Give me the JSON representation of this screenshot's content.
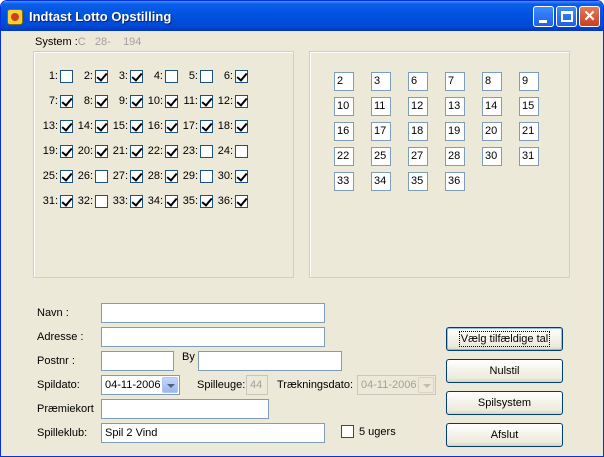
{
  "window": {
    "title": "Indtast Lotto Opstilling",
    "app_icon": "lotto-app-icon"
  },
  "system": {
    "label": "System :",
    "type": "C",
    "size": "28-",
    "rows": "194"
  },
  "numbers": [
    {
      "label": "1:",
      "checked": false
    },
    {
      "label": "2:",
      "checked": true
    },
    {
      "label": "3:",
      "checked": true
    },
    {
      "label": "4:",
      "checked": false
    },
    {
      "label": "5:",
      "checked": false
    },
    {
      "label": "6:",
      "checked": true
    },
    {
      "label": "7:",
      "checked": true
    },
    {
      "label": "8:",
      "checked": true
    },
    {
      "label": "9:",
      "checked": true
    },
    {
      "label": "10:",
      "checked": true
    },
    {
      "label": "11:",
      "checked": true
    },
    {
      "label": "12:",
      "checked": true
    },
    {
      "label": "13:",
      "checked": true
    },
    {
      "label": "14:",
      "checked": true
    },
    {
      "label": "15:",
      "checked": true
    },
    {
      "label": "16:",
      "checked": true
    },
    {
      "label": "17:",
      "checked": true
    },
    {
      "label": "18:",
      "checked": true
    },
    {
      "label": "19:",
      "checked": true
    },
    {
      "label": "20:",
      "checked": true
    },
    {
      "label": "21:",
      "checked": true
    },
    {
      "label": "22:",
      "checked": true
    },
    {
      "label": "23:",
      "checked": false
    },
    {
      "label": "24:",
      "checked": false
    },
    {
      "label": "25:",
      "checked": true
    },
    {
      "label": "26:",
      "checked": false
    },
    {
      "label": "27:",
      "checked": true
    },
    {
      "label": "28:",
      "checked": true
    },
    {
      "label": "29:",
      "checked": false
    },
    {
      "label": "30:",
      "checked": true
    },
    {
      "label": "31:",
      "checked": true
    },
    {
      "label": "32:",
      "checked": false
    },
    {
      "label": "33:",
      "checked": true
    },
    {
      "label": "34:",
      "checked": true
    },
    {
      "label": "35:",
      "checked": true
    },
    {
      "label": "36:",
      "checked": true
    }
  ],
  "selected_numbers": [
    "2",
    "3",
    "6",
    "7",
    "8",
    "9",
    "10",
    "11",
    "12",
    "13",
    "14",
    "15",
    "16",
    "17",
    "18",
    "19",
    "20",
    "21",
    "22",
    "25",
    "27",
    "28",
    "30",
    "31",
    "33",
    "34",
    "35",
    "36"
  ],
  "form": {
    "navn_label": "Navn :",
    "navn_value": "",
    "adresse_label": "Adresse :",
    "adresse_value": "",
    "postnr_label": "Postnr :",
    "postnr_value": "",
    "by_label": "By",
    "by_value": "",
    "spildato_label": "Spildato:",
    "spildato_value": "04-11-2006",
    "spilleuge_label": "Spilleuge:",
    "spilleuge_value": "44",
    "traekningsdato_label": "Trækningsdato:",
    "traekningsdato_value": "04-11-2006",
    "praemiekort_label": "Præmiekort",
    "praemiekort_value": "",
    "spilleklub_label": "Spilleklub:",
    "spilleklub_value": "Spil 2 Vind",
    "ugers_label": "5 ugers",
    "ugers_checked": false
  },
  "buttons": {
    "random": "Vælg tilfældige tal",
    "reset": "Nulstil",
    "system": "Spilsystem",
    "exit": "Afslut"
  }
}
